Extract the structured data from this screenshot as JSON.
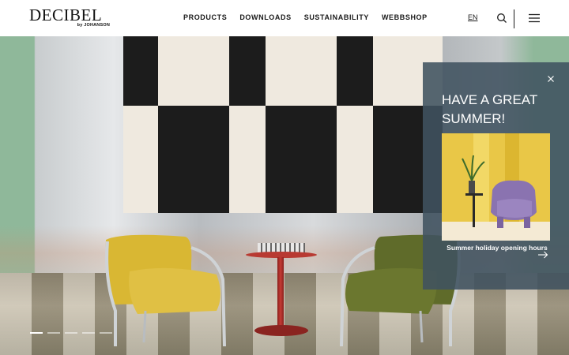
{
  "brand": {
    "name": "DECIBEL",
    "sub": "by JOHANSON"
  },
  "nav": {
    "items": [
      {
        "label": "PRODUCTS"
      },
      {
        "label": "DOWNLOADS"
      },
      {
        "label": "SUSTAINABILITY"
      },
      {
        "label": "WEBBSHOP"
      }
    ]
  },
  "header": {
    "language": "EN",
    "icons": {
      "search": "search-icon",
      "menu": "hamburger-menu-icon"
    }
  },
  "hero": {
    "slides_total": 5,
    "active_slide": 1
  },
  "popup": {
    "title": "HAVE A GREAT SUMMER!",
    "link_text": "Summer holiday opening hours",
    "close_icon": "close-icon",
    "arrow_icon": "arrow-right-icon"
  },
  "colors": {
    "popup_bg": "#405260",
    "chair_yellow": "#d9b733",
    "chair_green": "#5f6b2a",
    "accent_red": "#b83a32"
  }
}
